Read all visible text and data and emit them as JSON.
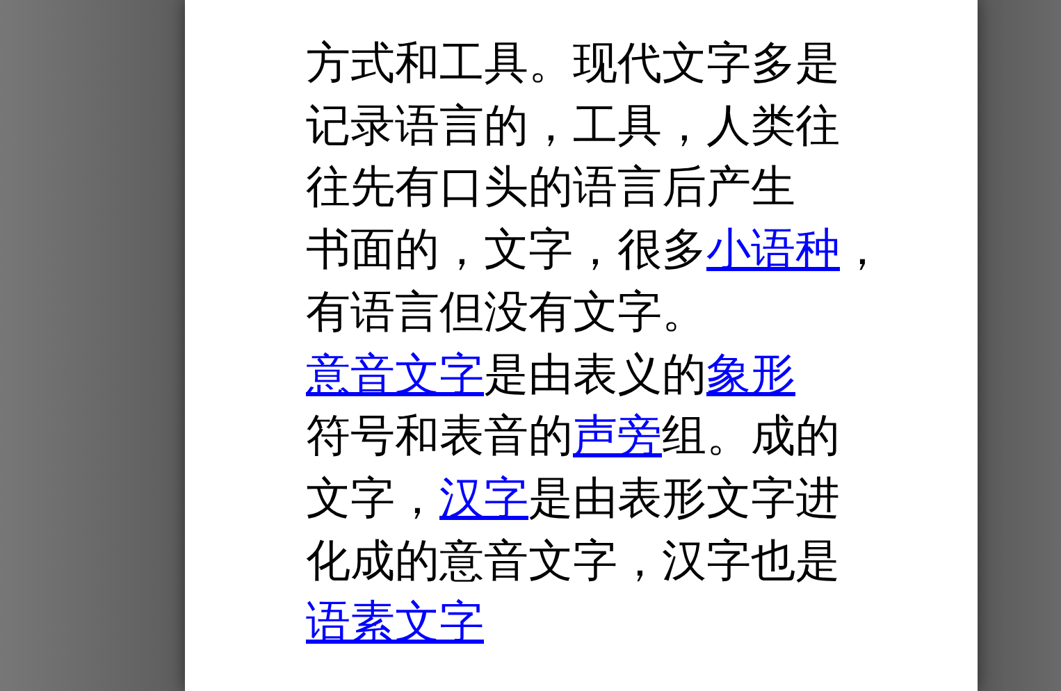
{
  "document": {
    "paragraphs": [
      {
        "lines": [
          [
            {
              "text": "方式和工具。现代文字多是"
            }
          ],
          [
            {
              "text": "记录语言的，工具，人类往"
            }
          ],
          [
            {
              "text": "往先有口头的语言后产生"
            }
          ],
          [
            {
              "text": "书面的，文字，很多"
            },
            {
              "text": "小语种",
              "kind": "link"
            },
            {
              "text": "，"
            }
          ],
          [
            {
              "text": "有语言但没有文字。"
            }
          ]
        ]
      },
      {
        "lines": [
          [
            {
              "text": "意音文字",
              "kind": "link"
            },
            {
              "text": "是由表义的"
            },
            {
              "text": "象形",
              "kind": "link"
            }
          ],
          [
            {
              "text": "符号和表音的"
            },
            {
              "text": "声旁",
              "kind": "link"
            },
            {
              "text": "组。成的"
            }
          ],
          [
            {
              "text": "文字，"
            },
            {
              "text": "汉字",
              "kind": "link"
            },
            {
              "text": "是由表形文字进"
            }
          ],
          [
            {
              "text": "化成的意音文字，汉字也是"
            }
          ],
          [
            {
              "text": "语素文字",
              "kind": "link"
            }
          ]
        ]
      }
    ]
  }
}
